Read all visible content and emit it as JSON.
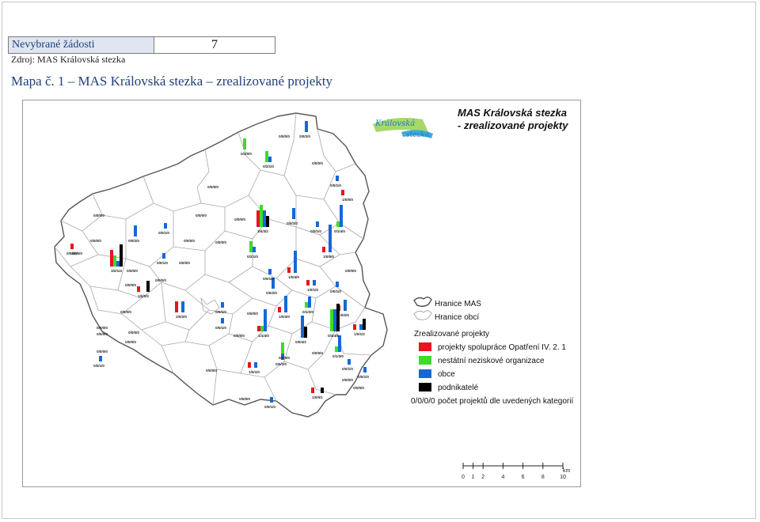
{
  "header": {
    "table_label": "Nevybrané žádosti",
    "table_value": "7",
    "source": "Zdroj: MAS Královská stezka",
    "map_title": "Mapa č. 1 – MAS Královská stezka – zrealizované projekty"
  },
  "map": {
    "title_line1": "MAS Královská stezka",
    "title_line2": "- zrealizované projekty",
    "logo_text_line1": "Královská",
    "logo_text_line2": "stezka",
    "legend": {
      "boundary_mas": "Hranice MAS",
      "boundary_obci": "Hranice obcí",
      "section_title": "Zrealizované projekty",
      "items": [
        {
          "label": "projekty spolupráce Opatření IV. 2. 1",
          "color": "#e8141b"
        },
        {
          "label": "nestátní neziskové organizace",
          "color": "#3cdc27"
        },
        {
          "label": "obce",
          "color": "#1568d8"
        },
        {
          "label": "podnikatelé",
          "color": "#000000"
        }
      ],
      "code_example": "0/0/0/0",
      "code_explanation": "počet projektů dle uvedených kategorií"
    },
    "scale": {
      "unit": "km",
      "ticks": [
        "0",
        "1",
        "2",
        "4",
        "6",
        "8",
        "10"
      ]
    },
    "municipalities": [
      {
        "code": "0/0/0/0",
        "bars": [
          0,
          0,
          0,
          0
        ]
      },
      {
        "code": "0/0/2/0",
        "bars": [
          0,
          0,
          2,
          0
        ]
      },
      {
        "code": "0/2/0/0",
        "bars": [
          0,
          2,
          0,
          0
        ]
      },
      {
        "code": "0/0/0/0",
        "bars": [
          0,
          0,
          0,
          0
        ]
      },
      {
        "code": "0/2/1/0",
        "bars": [
          0,
          2,
          1,
          0
        ]
      },
      {
        "code": "0/0/1/0",
        "bars": [
          0,
          0,
          1,
          0
        ]
      },
      {
        "code": "0/0/0/0",
        "bars": [
          0,
          0,
          0,
          0
        ]
      },
      {
        "code": "1/0/0/0",
        "bars": [
          1,
          0,
          0,
          0
        ]
      },
      {
        "code": "0/0/0/0",
        "bars": [
          0,
          0,
          0,
          0
        ]
      },
      {
        "code": "0/0/2/0",
        "bars": [
          0,
          0,
          2,
          0
        ]
      },
      {
        "code": "0/0/0/0",
        "bars": [
          0,
          0,
          0,
          0
        ]
      },
      {
        "code": "0/0/1/0",
        "bars": [
          0,
          0,
          1,
          0
        ]
      },
      {
        "code": "0/1/4/0",
        "bars": [
          0,
          1,
          4,
          0
        ]
      },
      {
        "code": "0/0/0/0",
        "bars": [
          0,
          0,
          0,
          0
        ]
      },
      {
        "code": "0/0/2/0",
        "bars": [
          0,
          0,
          2,
          0
        ]
      },
      {
        "code": "0/0/1/0",
        "bars": [
          0,
          0,
          1,
          0
        ]
      },
      {
        "code": "0/0/0/0",
        "bars": [
          0,
          0,
          0,
          0
        ]
      },
      {
        "code": "0/0/0/0",
        "bars": [
          0,
          0,
          0,
          0
        ]
      },
      {
        "code": "3/4/3/2",
        "bars": [
          3,
          4,
          3,
          2
        ]
      },
      {
        "code": "0/0/0/0",
        "bars": [
          0,
          0,
          0,
          0
        ]
      },
      {
        "code": "0/0/0/0",
        "bars": [
          0,
          0,
          0,
          0
        ]
      },
      {
        "code": "0/0/1/0",
        "bars": [
          0,
          0,
          1,
          0
        ]
      },
      {
        "code": "0/2/1/0",
        "bars": [
          0,
          2,
          1,
          0
        ]
      },
      {
        "code": "1/0/5/0",
        "bars": [
          1,
          0,
          5,
          0
        ]
      },
      {
        "code": "1/0/0/0",
        "bars": [
          1,
          0,
          0,
          0
        ]
      },
      {
        "code": "0/0/1/0",
        "bars": [
          0,
          0,
          1,
          0
        ]
      },
      {
        "code": "0/0/0/0",
        "bars": [
          0,
          0,
          0,
          0
        ]
      },
      {
        "code": "1/0/4/0",
        "bars": [
          1,
          0,
          4,
          0
        ]
      },
      {
        "code": "0/0/0/0",
        "bars": [
          0,
          0,
          0,
          0
        ]
      },
      {
        "code": "0/0/1/0",
        "bars": [
          0,
          0,
          1,
          0
        ]
      },
      {
        "code": "3/2/1/4",
        "bars": [
          3,
          2,
          1,
          4
        ]
      },
      {
        "code": "0/0/0/0",
        "bars": [
          0,
          0,
          0,
          0
        ]
      },
      {
        "code": "0/0/0/0",
        "bars": [
          0,
          0,
          0,
          0
        ]
      },
      {
        "code": "0/0/0/0",
        "bars": [
          0,
          0,
          0,
          0
        ]
      },
      {
        "code": "0/0/2/0",
        "bars": [
          0,
          0,
          2,
          0
        ]
      },
      {
        "code": "1/0/1/0",
        "bars": [
          1,
          0,
          1,
          0
        ]
      },
      {
        "code": "1/0/0/2",
        "bars": [
          1,
          0,
          0,
          2
        ]
      },
      {
        "code": "0/0/1/0",
        "bars": [
          0,
          0,
          1,
          0
        ]
      },
      {
        "code": "0/0/0/0",
        "bars": [
          0,
          0,
          0,
          0
        ]
      },
      {
        "code": "0/0/0/0",
        "bars": [
          0,
          0,
          0,
          0
        ]
      },
      {
        "code": "2/0/2/0",
        "bars": [
          2,
          0,
          2,
          0
        ]
      },
      {
        "code": "0/0/0/0",
        "bars": [
          0,
          0,
          0,
          0
        ]
      },
      {
        "code": "1/0/3/0",
        "bars": [
          1,
          0,
          3,
          0
        ]
      },
      {
        "code": "0/1/2/0",
        "bars": [
          0,
          1,
          2,
          0
        ]
      },
      {
        "code": "1/0/2/0",
        "bars": [
          1,
          0,
          2,
          0
        ]
      },
      {
        "code": "0/0/0/0",
        "bars": [
          0,
          0,
          0,
          0
        ]
      },
      {
        "code": "0/0/1/0",
        "bars": [
          0,
          0,
          1,
          0
        ]
      },
      {
        "code": "0/0/0/0",
        "bars": [
          0,
          0,
          0,
          0
        ]
      },
      {
        "code": "0/0/0/0",
        "bars": [
          0,
          0,
          0,
          0
        ]
      },
      {
        "code": "1/1/4/0",
        "bars": [
          1,
          1,
          4,
          0
        ]
      },
      {
        "code": "0/4/4/5",
        "bars": [
          0,
          4,
          4,
          5
        ]
      },
      {
        "code": "1/0/1/2",
        "bars": [
          1,
          0,
          1,
          2
        ]
      },
      {
        "code": "0/0/0/0",
        "bars": [
          0,
          0,
          0,
          0
        ]
      },
      {
        "code": "0/0/0/0",
        "bars": [
          0,
          0,
          0,
          0
        ]
      },
      {
        "code": "0/0/4/2",
        "bars": [
          0,
          0,
          4,
          2
        ]
      },
      {
        "code": "0/0/0/0",
        "bars": [
          0,
          0,
          0,
          0
        ]
      },
      {
        "code": "0/1/3/0",
        "bars": [
          0,
          1,
          3,
          0
        ]
      },
      {
        "code": "0/0/2/0",
        "bars": [
          0,
          0,
          2,
          0
        ]
      },
      {
        "code": "0/0/1/0",
        "bars": [
          0,
          0,
          1,
          0
        ]
      },
      {
        "code": "0/2/0/0",
        "bars": [
          0,
          2,
          0,
          0
        ]
      },
      {
        "code": "1/0/1/0",
        "bars": [
          1,
          0,
          1,
          0
        ]
      },
      {
        "code": "0/0/1/0",
        "bars": [
          0,
          0,
          1,
          0
        ]
      },
      {
        "code": "0/0/0/0",
        "bars": [
          0,
          0,
          0,
          0
        ]
      },
      {
        "code": "0/0/1/0",
        "bars": [
          0,
          0,
          1,
          0
        ]
      },
      {
        "code": "0/0/0/0",
        "bars": [
          0,
          0,
          0,
          0
        ]
      },
      {
        "code": "0/0/0/0",
        "bars": [
          0,
          0,
          0,
          0
        ]
      },
      {
        "code": "0/0/1/0",
        "bars": [
          0,
          0,
          1,
          0
        ]
      },
      {
        "code": "0/0/0/0",
        "bars": [
          0,
          0,
          0,
          0
        ]
      },
      {
        "code": "1/0/0/1",
        "bars": [
          1,
          0,
          0,
          1
        ]
      }
    ]
  }
}
